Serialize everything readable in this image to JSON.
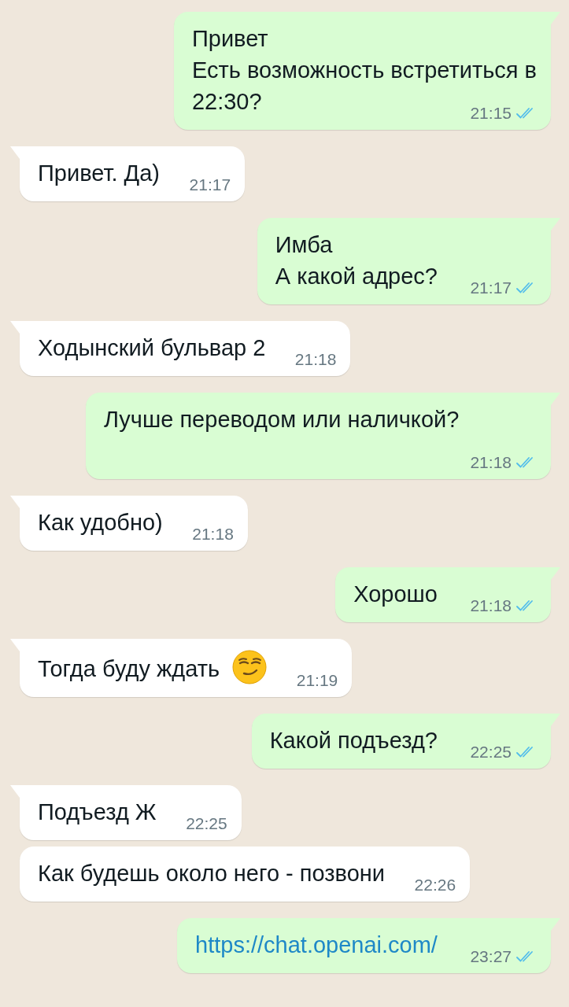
{
  "messages": [
    {
      "outgoing": true,
      "kind": "text",
      "tail": true,
      "lines": [
        "Привет",
        "Есть возможность встретиться в",
        "22:30?"
      ],
      "time": "21:15",
      "read": true
    },
    {
      "outgoing": false,
      "kind": "text",
      "tail": true,
      "lines": [
        "Привет. Да)"
      ],
      "time": "21:17"
    },
    {
      "outgoing": true,
      "kind": "text",
      "tail": true,
      "lines": [
        "Имба",
        "А какой адрес?"
      ],
      "time": "21:17",
      "read": true
    },
    {
      "outgoing": false,
      "kind": "text",
      "tail": true,
      "lines": [
        "Ходынский бульвар 2"
      ],
      "time": "21:18"
    },
    {
      "outgoing": true,
      "kind": "text",
      "tail": true,
      "lines": [
        "Лучше переводом или наличкой?"
      ],
      "time": "21:18",
      "read": true
    },
    {
      "outgoing": false,
      "kind": "text",
      "tail": true,
      "lines": [
        "Как удобно)"
      ],
      "time": "21:18"
    },
    {
      "outgoing": true,
      "kind": "text",
      "tail": true,
      "lines": [
        "Хорошо"
      ],
      "time": "21:18",
      "read": true
    },
    {
      "outgoing": false,
      "kind": "text",
      "tail": true,
      "emoji": true,
      "lines": [
        "Тогда буду ждать"
      ],
      "time": "21:19"
    },
    {
      "outgoing": true,
      "kind": "text",
      "tail": true,
      "lines": [
        "Какой подъезд?"
      ],
      "time": "22:25",
      "read": true
    },
    {
      "outgoing": false,
      "kind": "text",
      "tail": true,
      "lines": [
        "Подъезд Ж"
      ],
      "time": "22:25"
    },
    {
      "outgoing": false,
      "kind": "text",
      "tail": false,
      "lines": [
        "Как будешь около него - позвони"
      ],
      "time": "22:26"
    },
    {
      "outgoing": true,
      "kind": "link",
      "tail": true,
      "lines": [
        "https://chat.openai.com/"
      ],
      "time": "23:27",
      "read": true
    }
  ]
}
